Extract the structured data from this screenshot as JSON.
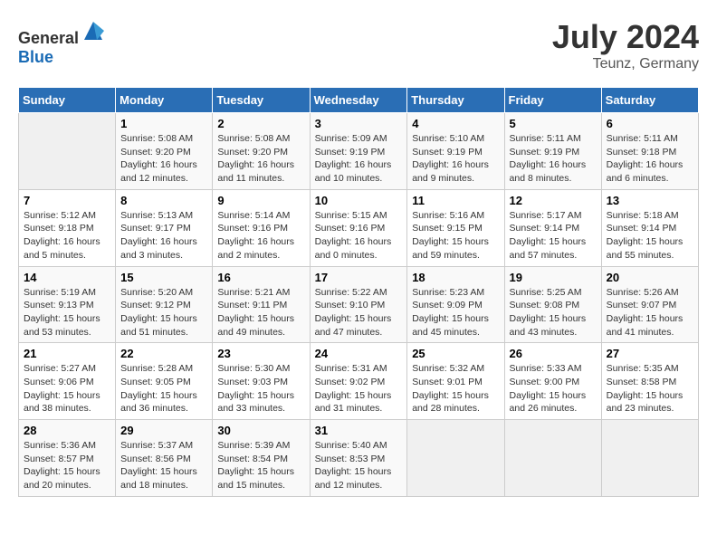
{
  "header": {
    "logo_general": "General",
    "logo_blue": "Blue",
    "month": "July 2024",
    "location": "Teunz, Germany"
  },
  "weekdays": [
    "Sunday",
    "Monday",
    "Tuesday",
    "Wednesday",
    "Thursday",
    "Friday",
    "Saturday"
  ],
  "weeks": [
    [
      {
        "day": "",
        "sunrise": "",
        "sunset": "",
        "daylight": ""
      },
      {
        "day": "1",
        "sunrise": "Sunrise: 5:08 AM",
        "sunset": "Sunset: 9:20 PM",
        "daylight": "Daylight: 16 hours and 12 minutes."
      },
      {
        "day": "2",
        "sunrise": "Sunrise: 5:08 AM",
        "sunset": "Sunset: 9:20 PM",
        "daylight": "Daylight: 16 hours and 11 minutes."
      },
      {
        "day": "3",
        "sunrise": "Sunrise: 5:09 AM",
        "sunset": "Sunset: 9:19 PM",
        "daylight": "Daylight: 16 hours and 10 minutes."
      },
      {
        "day": "4",
        "sunrise": "Sunrise: 5:10 AM",
        "sunset": "Sunset: 9:19 PM",
        "daylight": "Daylight: 16 hours and 9 minutes."
      },
      {
        "day": "5",
        "sunrise": "Sunrise: 5:11 AM",
        "sunset": "Sunset: 9:19 PM",
        "daylight": "Daylight: 16 hours and 8 minutes."
      },
      {
        "day": "6",
        "sunrise": "Sunrise: 5:11 AM",
        "sunset": "Sunset: 9:18 PM",
        "daylight": "Daylight: 16 hours and 6 minutes."
      }
    ],
    [
      {
        "day": "7",
        "sunrise": "Sunrise: 5:12 AM",
        "sunset": "Sunset: 9:18 PM",
        "daylight": "Daylight: 16 hours and 5 minutes."
      },
      {
        "day": "8",
        "sunrise": "Sunrise: 5:13 AM",
        "sunset": "Sunset: 9:17 PM",
        "daylight": "Daylight: 16 hours and 3 minutes."
      },
      {
        "day": "9",
        "sunrise": "Sunrise: 5:14 AM",
        "sunset": "Sunset: 9:16 PM",
        "daylight": "Daylight: 16 hours and 2 minutes."
      },
      {
        "day": "10",
        "sunrise": "Sunrise: 5:15 AM",
        "sunset": "Sunset: 9:16 PM",
        "daylight": "Daylight: 16 hours and 0 minutes."
      },
      {
        "day": "11",
        "sunrise": "Sunrise: 5:16 AM",
        "sunset": "Sunset: 9:15 PM",
        "daylight": "Daylight: 15 hours and 59 minutes."
      },
      {
        "day": "12",
        "sunrise": "Sunrise: 5:17 AM",
        "sunset": "Sunset: 9:14 PM",
        "daylight": "Daylight: 15 hours and 57 minutes."
      },
      {
        "day": "13",
        "sunrise": "Sunrise: 5:18 AM",
        "sunset": "Sunset: 9:14 PM",
        "daylight": "Daylight: 15 hours and 55 minutes."
      }
    ],
    [
      {
        "day": "14",
        "sunrise": "Sunrise: 5:19 AM",
        "sunset": "Sunset: 9:13 PM",
        "daylight": "Daylight: 15 hours and 53 minutes."
      },
      {
        "day": "15",
        "sunrise": "Sunrise: 5:20 AM",
        "sunset": "Sunset: 9:12 PM",
        "daylight": "Daylight: 15 hours and 51 minutes."
      },
      {
        "day": "16",
        "sunrise": "Sunrise: 5:21 AM",
        "sunset": "Sunset: 9:11 PM",
        "daylight": "Daylight: 15 hours and 49 minutes."
      },
      {
        "day": "17",
        "sunrise": "Sunrise: 5:22 AM",
        "sunset": "Sunset: 9:10 PM",
        "daylight": "Daylight: 15 hours and 47 minutes."
      },
      {
        "day": "18",
        "sunrise": "Sunrise: 5:23 AM",
        "sunset": "Sunset: 9:09 PM",
        "daylight": "Daylight: 15 hours and 45 minutes."
      },
      {
        "day": "19",
        "sunrise": "Sunrise: 5:25 AM",
        "sunset": "Sunset: 9:08 PM",
        "daylight": "Daylight: 15 hours and 43 minutes."
      },
      {
        "day": "20",
        "sunrise": "Sunrise: 5:26 AM",
        "sunset": "Sunset: 9:07 PM",
        "daylight": "Daylight: 15 hours and 41 minutes."
      }
    ],
    [
      {
        "day": "21",
        "sunrise": "Sunrise: 5:27 AM",
        "sunset": "Sunset: 9:06 PM",
        "daylight": "Daylight: 15 hours and 38 minutes."
      },
      {
        "day": "22",
        "sunrise": "Sunrise: 5:28 AM",
        "sunset": "Sunset: 9:05 PM",
        "daylight": "Daylight: 15 hours and 36 minutes."
      },
      {
        "day": "23",
        "sunrise": "Sunrise: 5:30 AM",
        "sunset": "Sunset: 9:03 PM",
        "daylight": "Daylight: 15 hours and 33 minutes."
      },
      {
        "day": "24",
        "sunrise": "Sunrise: 5:31 AM",
        "sunset": "Sunset: 9:02 PM",
        "daylight": "Daylight: 15 hours and 31 minutes."
      },
      {
        "day": "25",
        "sunrise": "Sunrise: 5:32 AM",
        "sunset": "Sunset: 9:01 PM",
        "daylight": "Daylight: 15 hours and 28 minutes."
      },
      {
        "day": "26",
        "sunrise": "Sunrise: 5:33 AM",
        "sunset": "Sunset: 9:00 PM",
        "daylight": "Daylight: 15 hours and 26 minutes."
      },
      {
        "day": "27",
        "sunrise": "Sunrise: 5:35 AM",
        "sunset": "Sunset: 8:58 PM",
        "daylight": "Daylight: 15 hours and 23 minutes."
      }
    ],
    [
      {
        "day": "28",
        "sunrise": "Sunrise: 5:36 AM",
        "sunset": "Sunset: 8:57 PM",
        "daylight": "Daylight: 15 hours and 20 minutes."
      },
      {
        "day": "29",
        "sunrise": "Sunrise: 5:37 AM",
        "sunset": "Sunset: 8:56 PM",
        "daylight": "Daylight: 15 hours and 18 minutes."
      },
      {
        "day": "30",
        "sunrise": "Sunrise: 5:39 AM",
        "sunset": "Sunset: 8:54 PM",
        "daylight": "Daylight: 15 hours and 15 minutes."
      },
      {
        "day": "31",
        "sunrise": "Sunrise: 5:40 AM",
        "sunset": "Sunset: 8:53 PM",
        "daylight": "Daylight: 15 hours and 12 minutes."
      },
      {
        "day": "",
        "sunrise": "",
        "sunset": "",
        "daylight": ""
      },
      {
        "day": "",
        "sunrise": "",
        "sunset": "",
        "daylight": ""
      },
      {
        "day": "",
        "sunrise": "",
        "sunset": "",
        "daylight": ""
      }
    ]
  ]
}
